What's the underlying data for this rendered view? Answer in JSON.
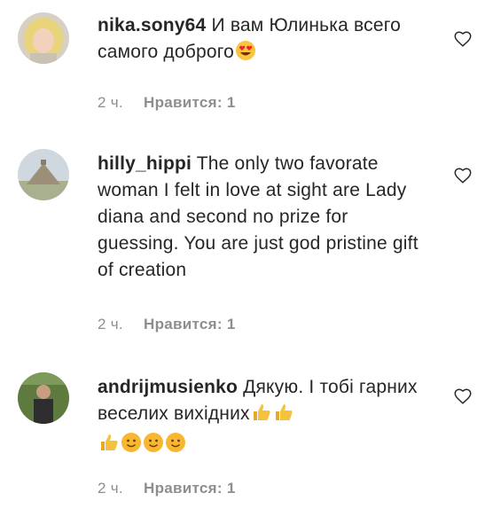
{
  "comments": [
    {
      "username": "nika.sony64",
      "text": "И вам Юлинька всего самого доброго",
      "emojis": [
        "heart-eyes-emoji-icon"
      ],
      "time": "2 ч.",
      "likes": "Нравится: 1",
      "avatar": "avatar-blonde-woman"
    },
    {
      "username": "hilly_hippi",
      "text": "The only two favorate woman I felt in love at sight are Lady diana and second no prize for guessing. You are just god pristine gift of creation",
      "emojis": [],
      "time": "2 ч.",
      "likes": "Нравится: 1",
      "avatar": "avatar-pyramid"
    },
    {
      "username": "andrijmusienko",
      "text": "Дякую. І тобі гарних веселих вихідних",
      "emojis": [
        "thumbs-up-emoji-icon",
        "thumbs-up-emoji-icon",
        "thumbs-up-emoji-icon",
        "smile-emoji-icon",
        "smile-emoji-icon",
        "smile-emoji-icon"
      ],
      "time": "2 ч.",
      "likes": "Нравится: 1",
      "avatar": "avatar-man-outdoors"
    }
  ],
  "colors": {
    "text": "#262626",
    "meta": "#8e8e8e",
    "heart_outline": "#262626"
  },
  "icons": {
    "like": "heart-outline-icon"
  }
}
